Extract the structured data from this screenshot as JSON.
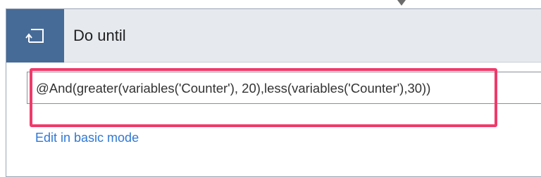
{
  "action": {
    "title": "Do until",
    "icon": "loop-return-icon",
    "header_color": "#e6eaef",
    "icon_tile_color": "#476b97"
  },
  "condition": {
    "expression": "@And(greater(variables('Counter'), 20),less(variables('Counter'),30))"
  },
  "links": {
    "edit_basic_mode": "Edit in basic mode"
  },
  "colors": {
    "highlight": "#ef3a6b",
    "link": "#2f78d6"
  }
}
